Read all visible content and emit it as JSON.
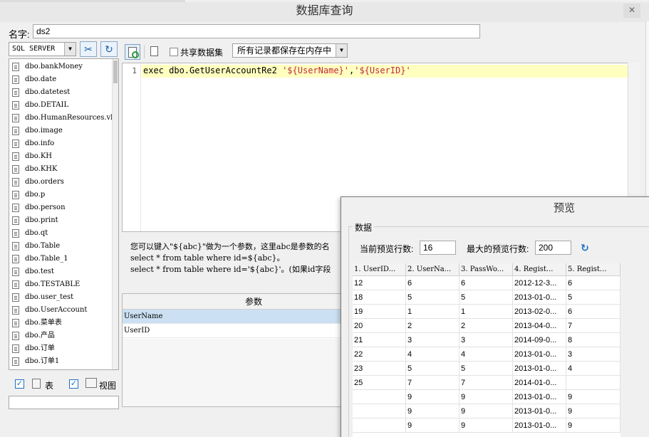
{
  "window": {
    "title": "数据库查询",
    "close_glyph": "✕"
  },
  "name_field": {
    "label": "名字:",
    "value": "ds2"
  },
  "db_type": {
    "value": "SQL SERVER"
  },
  "toolbar": {
    "share_label": "共享数据集",
    "memory_option": "所有记录都保存在内存中"
  },
  "tables": [
    "dbo.bankMoney",
    "dbo.date",
    "dbo.datetest",
    "dbo.DETAIL",
    "dbo.HumanResources.vl",
    "dbo.image",
    "dbo.info",
    "dbo.KH",
    "dbo.KHK",
    "dbo.orders",
    "dbo.p",
    "dbo.person",
    "dbo.print",
    "dbo.qt",
    "dbo.Table",
    "dbo.Table_1",
    "dbo.test",
    "dbo.TESTABLE",
    "dbo.user_test",
    "dbo.UserAccount",
    "dbo.菜单表",
    "dbo.产品",
    "dbo.订单",
    "dbo.订单1"
  ],
  "filters": {
    "table_label": "表",
    "view_label": "视图",
    "check_glyph": "✓"
  },
  "editor": {
    "line_number": "1",
    "code_prefix": "exec dbo.GetUserAccountRe2 ",
    "code_arg1": "'${UserName}'",
    "code_comma": ",",
    "code_arg2": "'${UserID}'"
  },
  "hints": [
    "您可以键入\"${abc}\"做为一个参数，这里abc是参数的名",
    "select * from table where id=${abc}。",
    "select * from table where id='${abc}'。(如果id字段"
  ],
  "params": {
    "header": "参数",
    "rows": [
      "UserName",
      "UserID"
    ]
  },
  "preview": {
    "title": "预览",
    "group_label": "数据",
    "current_rows_label": "当前预览行数:",
    "current_rows_value": "16",
    "max_rows_label": "最大的预览行数:",
    "max_rows_value": "200",
    "refresh_glyph": "↻",
    "columns": [
      "1. UserID...",
      "2. UserNa...",
      "3. PassWo...",
      "4. Regist...",
      "5. Regist..."
    ],
    "rows": [
      [
        "12",
        "6",
        "6",
        "2012-12-3...",
        "6"
      ],
      [
        "18",
        "5",
        "5",
        "2013-01-0...",
        "5"
      ],
      [
        "19",
        "1",
        "1",
        "2013-02-0...",
        "6"
      ],
      [
        "20",
        "2",
        "2",
        "2013-04-0...",
        "7"
      ],
      [
        "21",
        "3",
        "3",
        "2014-09-0...",
        "8"
      ],
      [
        "22",
        "4",
        "4",
        "2013-01-0...",
        "3"
      ],
      [
        "23",
        "5",
        "5",
        "2013-01-0...",
        "4"
      ],
      [
        "25",
        "7",
        "7",
        "2014-01-0...",
        ""
      ],
      [
        "",
        "9",
        "9",
        "2013-01-0...",
        "9"
      ],
      [
        "",
        "9",
        "9",
        "2013-01-0...",
        "9"
      ],
      [
        "",
        "9",
        "9",
        "2013-01-0...",
        "9"
      ]
    ]
  }
}
